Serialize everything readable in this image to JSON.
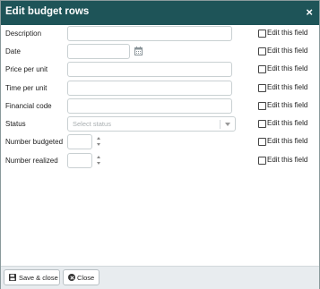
{
  "dialog": {
    "title": "Edit budget rows",
    "close_glyph": "×"
  },
  "fields": [
    {
      "label": "Description"
    },
    {
      "label": "Date"
    },
    {
      "label": "Price per unit"
    },
    {
      "label": "Time per unit"
    },
    {
      "label": "Financial code"
    },
    {
      "label": "Status",
      "placeholder": "Select status"
    },
    {
      "label": "Number budgeted"
    },
    {
      "label": "Number realized"
    }
  ],
  "edit_this_field_label": "Edit this field",
  "footer": {
    "save_close_label": "Save & close",
    "close_label": "Close"
  },
  "colors": {
    "titlebar": "#1e5458",
    "footer": "#e8ecef"
  }
}
